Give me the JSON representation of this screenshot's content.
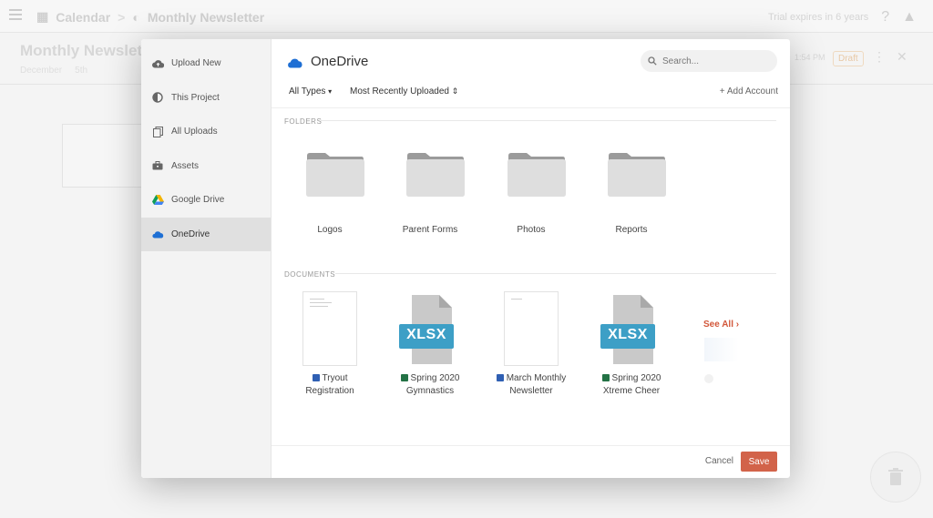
{
  "background": {
    "breadcrumb": [
      "Calendar",
      "Monthly Newsletter"
    ],
    "crumb_sep": ">",
    "top_right_text": "Trial expires in 6 years",
    "page_title": "Monthly Newsletter",
    "sub_items": [
      "December",
      "5th"
    ],
    "time_text": "1:54 PM",
    "status_badge": "Draft"
  },
  "sidebar": {
    "items": [
      {
        "label": "Upload New",
        "icon": "cloud-upload-icon"
      },
      {
        "label": "This Project",
        "icon": "project-icon"
      },
      {
        "label": "All Uploads",
        "icon": "uploads-icon"
      },
      {
        "label": "Assets",
        "icon": "briefcase-icon"
      },
      {
        "label": "Google Drive",
        "icon": "google-drive-icon"
      },
      {
        "label": "OneDrive",
        "icon": "onedrive-icon",
        "active": true
      }
    ]
  },
  "header": {
    "title": "OneDrive",
    "search_placeholder": "Search...",
    "filter_type": "All Types",
    "filter_type_caret": "▾",
    "filter_sort": "Most Recently Uploaded",
    "filter_sort_caret": "⇕",
    "add_account": "+ Add Account"
  },
  "folders": {
    "label": "FOLDERS",
    "items": [
      "Logos",
      "Parent Forms",
      "Photos",
      "Reports"
    ]
  },
  "documents": {
    "label": "DOCUMENTS",
    "items": [
      {
        "line1": "Tryout",
        "line2": "Registration",
        "type": "word"
      },
      {
        "line1": "Spring 2020",
        "line2": "Gymnastics",
        "type": "excel",
        "badge": "XLSX"
      },
      {
        "line1": "March Monthly",
        "line2": "Newsletter",
        "type": "word"
      },
      {
        "line1": "Spring 2020",
        "line2": "Xtreme Cheer",
        "type": "excel",
        "badge": "XLSX"
      }
    ],
    "see_all": "See All ›"
  },
  "footer": {
    "cancel": "Cancel",
    "save": "Save"
  },
  "colors": {
    "accent": "#d2634a",
    "onedrive_blue": "#1e6fd4",
    "xlsx_badge": "#3d9fc6",
    "word_blue": "#2f5fb3",
    "excel_green": "#237245"
  }
}
